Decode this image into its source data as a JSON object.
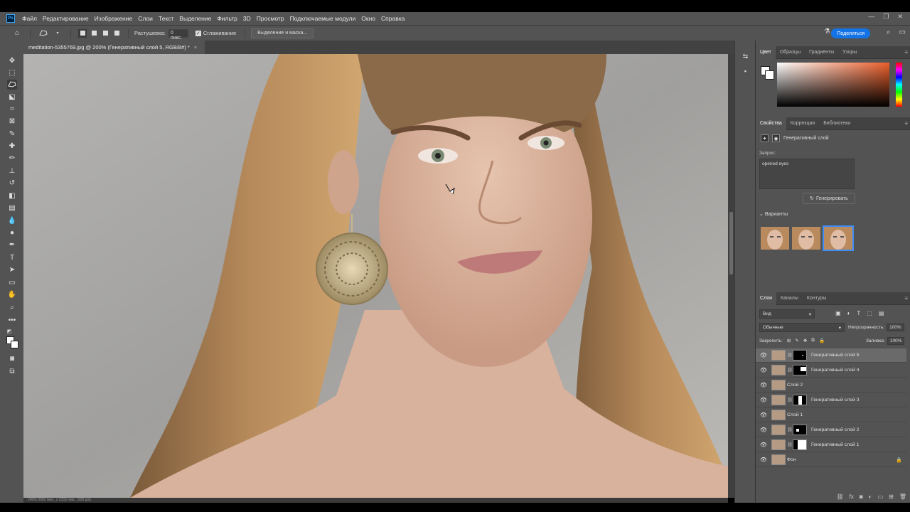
{
  "menubar": {
    "logo": "Ps",
    "items": [
      "Файл",
      "Редактирование",
      "Изображение",
      "Слои",
      "Текст",
      "Выделение",
      "Фильтр",
      "3D",
      "Просмотр",
      "Подключаемые модули",
      "Окно",
      "Справка"
    ],
    "window_controls": [
      "—",
      "❐",
      "✕"
    ]
  },
  "options": {
    "feather_label": "Растушевка:",
    "feather_value": "0 пикс.",
    "antialias_label": "Сглаживание",
    "select_mask_label": "Выделение и маска...",
    "share_label": "Поделиться"
  },
  "document": {
    "tab_title": "meditation-5355769.jpg @ 200% (Генеративный слой 5, RGB/8#) *",
    "close_glyph": "×",
    "status": "200%     3500 пикс. x 2333 пикс. (300 ppi)"
  },
  "color_panel": {
    "tabs": [
      "Цвет",
      "Образцы",
      "Градиенты",
      "Узоры"
    ],
    "accent_color": "#ec5f2b"
  },
  "properties": {
    "tabs": [
      "Свойства",
      "Коррекция",
      "Библиотеки"
    ],
    "layer_type": "Генеративный слой",
    "prompt_label": "Запрос:",
    "prompt_value": "opened eyes",
    "generate_label": "Генерировать",
    "variants_label": "Варианты"
  },
  "layers_panel": {
    "tabs": [
      "Слои",
      "Каналы",
      "Контуры"
    ],
    "search_label": "Вид",
    "blend_mode": "Обычные",
    "opacity_label": "Непрозрачность:",
    "opacity_value": "100%",
    "lock_label": "Закрепить:",
    "fill_label": "Заливка:",
    "fill_value": "100%",
    "layers": [
      {
        "name": "Генеративный слой 5"
      },
      {
        "name": "Генеративный слой 4"
      },
      {
        "name": "Слой 2"
      },
      {
        "name": "Генеративный слой 3"
      },
      {
        "name": "Слой 1"
      },
      {
        "name": "Генеративный слой 2"
      },
      {
        "name": "Генеративный слой 1"
      },
      {
        "name": "Фон"
      }
    ]
  }
}
